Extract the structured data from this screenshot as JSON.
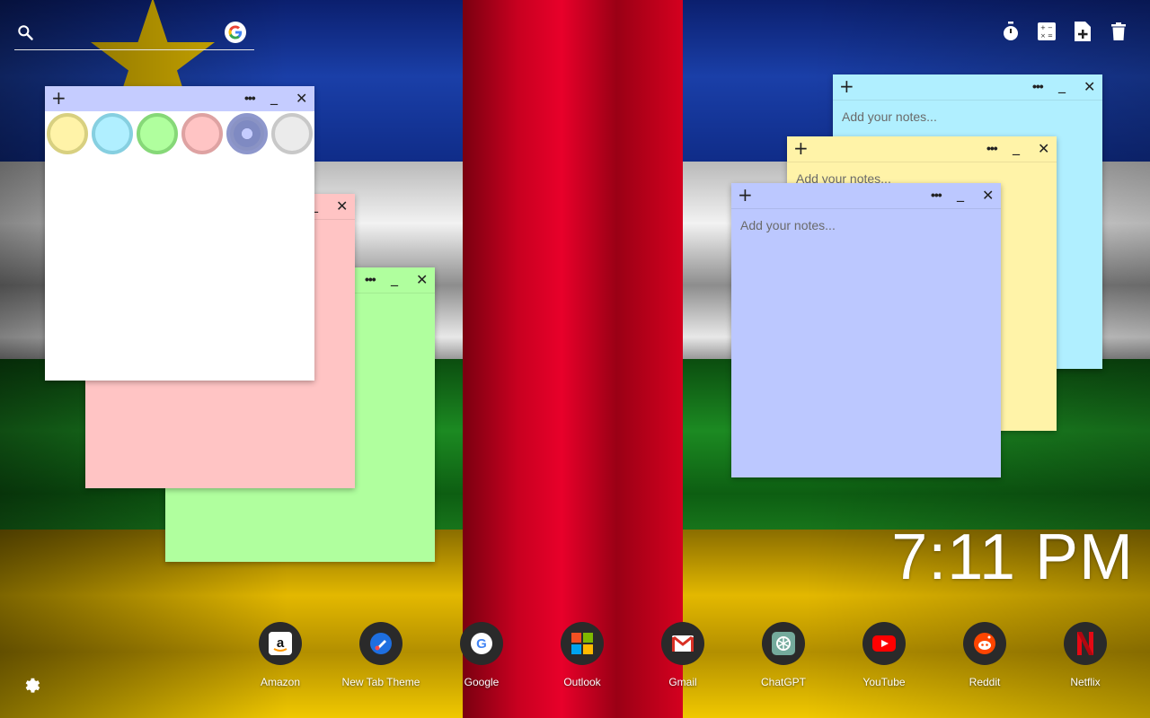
{
  "search": {
    "placeholder": ""
  },
  "toolbar": {
    "icons": [
      "timer-icon",
      "calculator-icon",
      "new-note-icon",
      "trash-icon"
    ]
  },
  "notes": {
    "placeholder": "Add your notes...",
    "plus": "+",
    "dots": "•••",
    "min": "_",
    "close": "✕",
    "color_swatches": [
      "#fff3a8",
      "#b0efff",
      "#b0ff9e",
      "#ffc4c4",
      "#c5ccff",
      "#ebebeb"
    ]
  },
  "clock": {
    "time": "7:11 PM"
  },
  "shortcuts": [
    {
      "label": "Amazon"
    },
    {
      "label": "New Tab Theme"
    },
    {
      "label": "Google"
    },
    {
      "label": "Outlook"
    },
    {
      "label": "Gmail"
    },
    {
      "label": "ChatGPT"
    },
    {
      "label": "YouTube"
    },
    {
      "label": "Reddit"
    },
    {
      "label": "Netflix"
    }
  ]
}
